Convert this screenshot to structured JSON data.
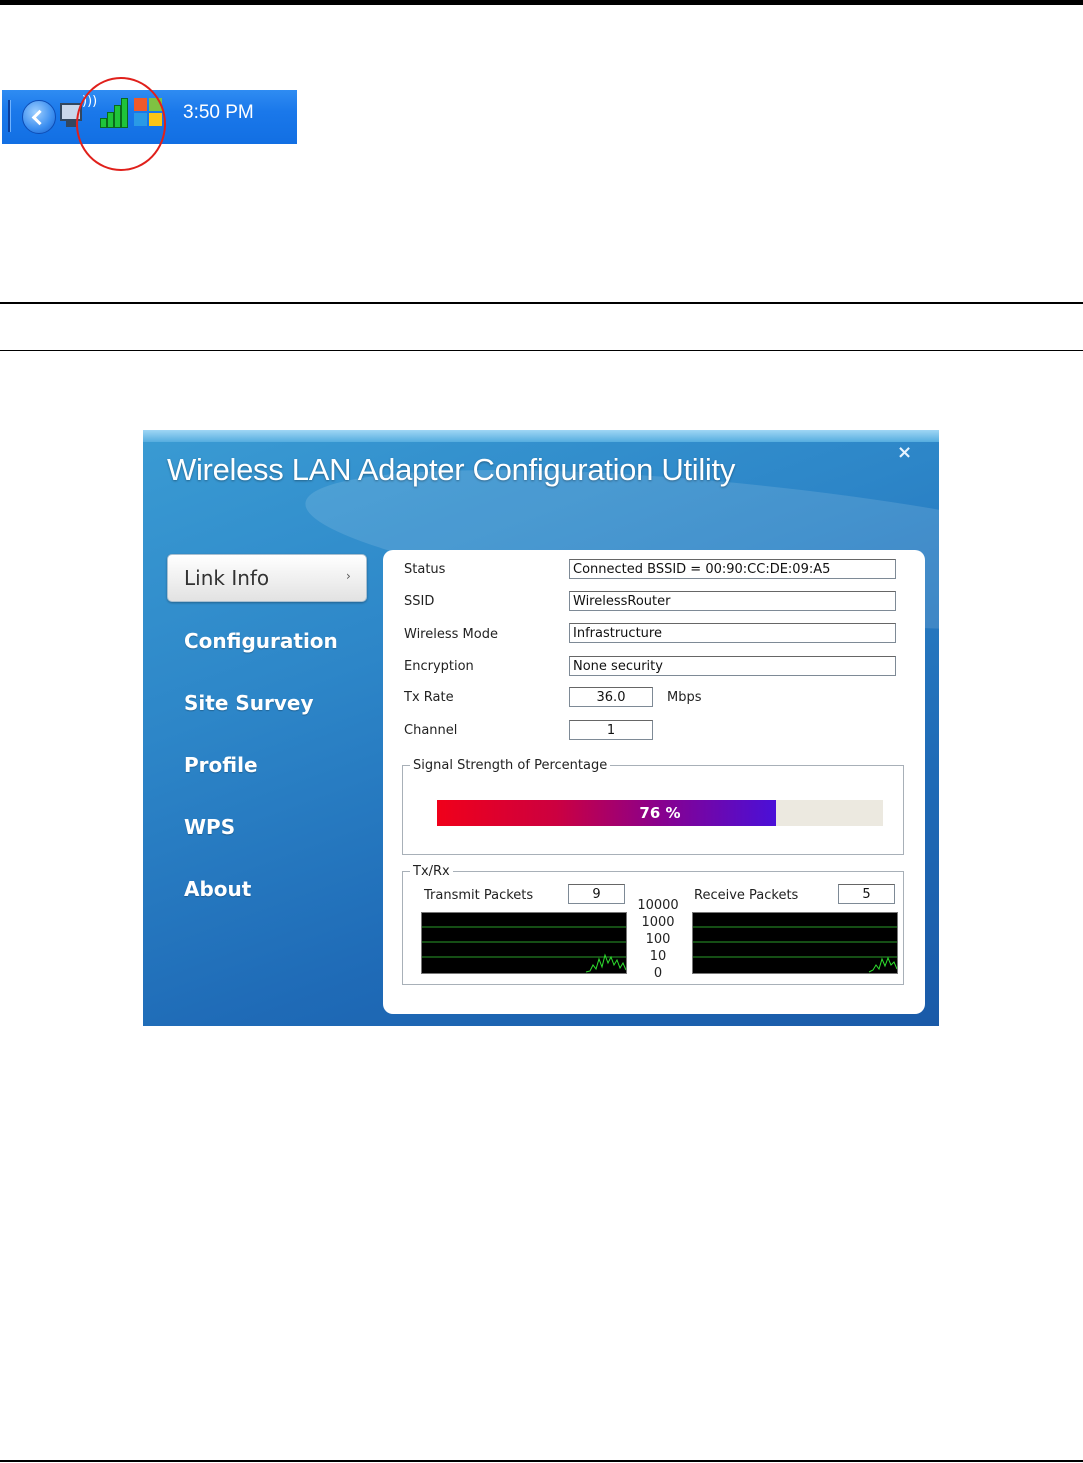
{
  "taskbar": {
    "clock": "3:50 PM",
    "icons": [
      "back-arrow-icon",
      "network-computer-icon",
      "wifi-waves-icon",
      "signal-bars-icon",
      "windows-flag-icon"
    ]
  },
  "window": {
    "title": "Wireless LAN Adapter Configuration Utility",
    "close_label": "×"
  },
  "nav": {
    "active": "Link Info",
    "items": [
      "Configuration",
      "Site Survey",
      "Profile",
      "WPS",
      "About"
    ]
  },
  "link_info": {
    "status_label": "Status",
    "status_value": "Connected BSSID = 00:90:CC:DE:09:A5",
    "ssid_label": "SSID",
    "ssid_value": "WirelessRouter",
    "mode_label": "Wireless Mode",
    "mode_value": "Infrastructure",
    "encryption_label": "Encryption",
    "encryption_value": "None security",
    "txrate_label": "Tx Rate",
    "txrate_value": "36.0",
    "txrate_unit": "Mbps",
    "channel_label": "Channel",
    "channel_value": "1"
  },
  "signal": {
    "group_title": "Signal Strength of Percentage",
    "percent": 76,
    "percent_text": "76 %"
  },
  "txrx": {
    "group_title": "Tx/Rx",
    "transmit_label": "Transmit Packets",
    "transmit_value": "9",
    "receive_label": "Receive Packets",
    "receive_value": "5",
    "scale": [
      "10000",
      "1000",
      "100",
      "10",
      "0"
    ]
  },
  "colors": {
    "accent_blue": "#2d86c8",
    "graph_line": "#2ee02e",
    "annotation_red": "#e0201b"
  }
}
